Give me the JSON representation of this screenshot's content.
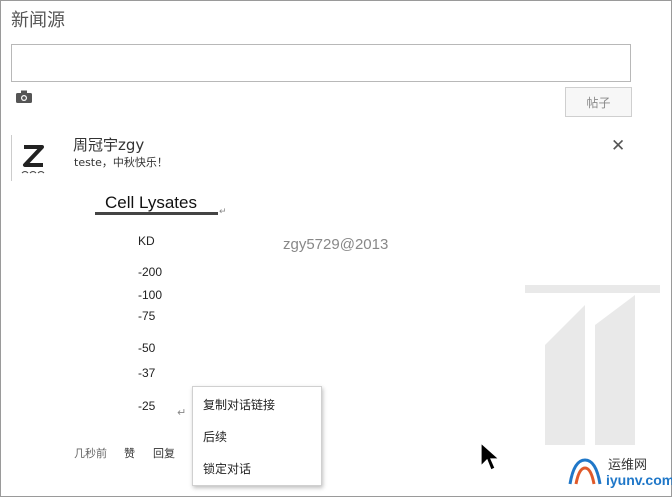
{
  "feed": {
    "title": "新闻源",
    "composer_placeholder": "",
    "post_button": "帖子",
    "camera_icon": "camera-icon"
  },
  "post": {
    "author": "周冠宇zgy",
    "message": "teste，中秋快乐！",
    "close_symbol": "✕",
    "image": {
      "heading": "Cell Lysates",
      "unit_label": "KD",
      "markers": [
        "-200",
        "-100",
        "-75",
        "-50",
        "-37",
        "-25"
      ],
      "watermark": "zgy5729@2013"
    },
    "meta": {
      "time": "几秒前",
      "like": "赞",
      "reply": "回复"
    }
  },
  "context_menu": {
    "items": [
      "复制对话链接",
      "后续",
      "锁定对话"
    ]
  },
  "site_logo": {
    "cn": "运维网",
    "en": "iyunv.com"
  }
}
